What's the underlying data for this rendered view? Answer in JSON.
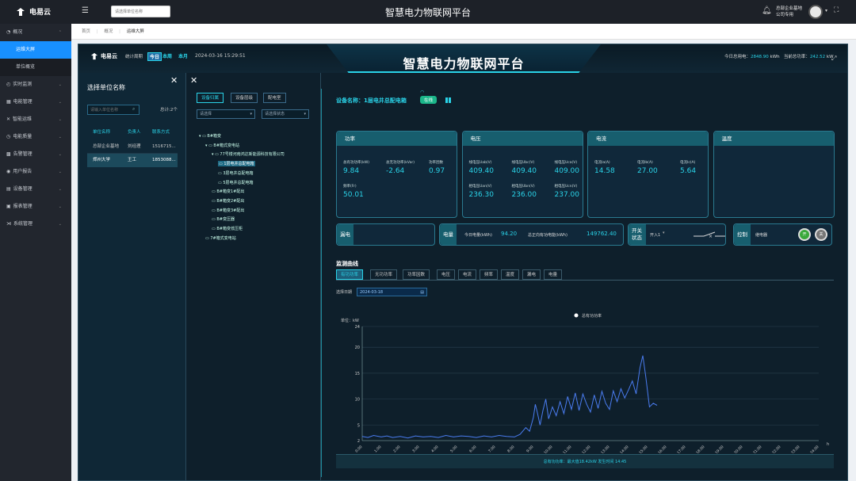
{
  "topbar": {
    "logo_text": "电易云",
    "menu_icon": "☰",
    "search_placeholder": "请选择单位名称",
    "title": "智慧电力物联网平台",
    "user_line1": "总部企业基地",
    "user_line2": "公司专用"
  },
  "sidebar": {
    "items": [
      {
        "label": "概况",
        "icon": "◔",
        "expanded": true
      },
      {
        "label": "运维大屏",
        "sub": true,
        "active": true
      },
      {
        "label": "单位概览",
        "sub": true
      },
      {
        "label": "实时监测",
        "icon": "◴"
      },
      {
        "label": "电能管理",
        "icon": "▦"
      },
      {
        "label": "智能运维",
        "icon": "✕"
      },
      {
        "label": "电能质量",
        "icon": "◷"
      },
      {
        "label": "告警管理",
        "icon": "▩"
      },
      {
        "label": "用户报告",
        "icon": "◉"
      },
      {
        "label": "设备管理",
        "icon": "▤"
      },
      {
        "label": "报表管理",
        "icon": "▣"
      },
      {
        "label": "系统管理",
        "icon": "⋊"
      }
    ]
  },
  "breadcrumb": [
    "首页",
    "概况",
    "运维大屏"
  ],
  "screen": {
    "logo_text": "电易云",
    "stat_label": "统计周期",
    "periods": [
      "今日",
      "本周",
      "本月"
    ],
    "time": "2024-03-16 15:29:51",
    "title": "智慧电力物联网平台",
    "today_label": "今日总用电：",
    "today_value": "2848.90",
    "today_unit": "kWh",
    "power_label": "当前总功率：",
    "power_value": "242.52",
    "power_unit": "kW"
  },
  "units_panel": {
    "title": "选择单位名称",
    "search_placeholder": "请输入单位名称",
    "total": "总计:2个",
    "headers": [
      "单位名称",
      "负责人",
      "联系方式"
    ],
    "rows": [
      [
        "总部企业基地",
        "刘经理",
        "1516715..."
      ],
      [
        "郑州大学",
        "王工",
        "1853088..."
      ]
    ]
  },
  "tree_panel": {
    "tabs": [
      "设备归属",
      "设备层级",
      "配电室"
    ],
    "select1": "请选择",
    "select2": "请选择状态",
    "nodes": [
      {
        "label": "B#箱变",
        "depth": 0
      },
      {
        "label": "B#箱式变电站",
        "depth": 1
      },
      {
        "label": "77号楼河南鸿达新能源科技有限公司",
        "depth": 2
      },
      {
        "label": "1层电井总配电箱",
        "depth": 3,
        "highlight": true
      },
      {
        "label": "3层电井总配电箱",
        "depth": 3
      },
      {
        "label": "5层电井总配电箱",
        "depth": 3
      },
      {
        "label": "B#箱变1#配出",
        "depth": 2
      },
      {
        "label": "B#箱变2#配出",
        "depth": 2
      },
      {
        "label": "B#箱变3#配出",
        "depth": 2
      },
      {
        "label": "B#变压器",
        "depth": 2
      },
      {
        "label": "B#箱变低压柜",
        "depth": 2
      },
      {
        "label": "7#箱式变电站",
        "depth": 1
      }
    ]
  },
  "detail": {
    "device_label": "设备名称：1层电井总配电箱",
    "status": "在线",
    "cards": [
      {
        "title": "功率",
        "metrics": [
          {
            "label": "总有功功率(kW)",
            "value": "9.84"
          },
          {
            "label": "总无功功率(kVar)",
            "value": "-2.64"
          },
          {
            "label": "功率因数",
            "value": "0.97"
          },
          {
            "label": "频率(Fr)",
            "value": "50.01"
          }
        ]
      },
      {
        "title": "电压",
        "metrics": [
          {
            "label": "线电压Uab(V)",
            "value": "409.40"
          },
          {
            "label": "线电压Ubc(V)",
            "value": "409.40"
          },
          {
            "label": "线电压Uca(V)",
            "value": "409.00"
          },
          {
            "label": "相电压Uan(V)",
            "value": "236.30"
          },
          {
            "label": "相电压Ubn(V)",
            "value": "236.00"
          },
          {
            "label": "相电压Ucn(V)",
            "value": "237.00"
          }
        ]
      },
      {
        "title": "电流",
        "metrics": [
          {
            "label": "电流Ia(A)",
            "value": "14.58"
          },
          {
            "label": "电流Ib(A)",
            "value": "27.00"
          },
          {
            "label": "电流Ic(A)",
            "value": "5.64"
          }
        ]
      },
      {
        "title": "温度",
        "metrics": []
      }
    ],
    "leak_label": "漏电",
    "energy_label": "电量",
    "energy_today_label": "今日电量(kWh)",
    "energy_today_value": "94.20",
    "energy_total_label": "总正向有功电能(kWh)",
    "energy_total_value": "149762.40",
    "switch_label": "开关状态",
    "switch_value": "开入1",
    "control_label": "控制",
    "control_device": "继电器",
    "control_on": "开",
    "control_off": "关",
    "section_title": "监测曲线",
    "tabs": [
      "有功功率",
      "无功功率",
      "功率因数",
      "电压",
      "电流",
      "频率",
      "温度",
      "漏电",
      "电量"
    ],
    "date_label": "选择日期",
    "date_value": "2024-03-18",
    "footer": "总有功功率：最大值18.42kW 发生时间 14:45"
  },
  "chart_data": {
    "type": "line",
    "legend": "总有功功率",
    "ylabel": "单位：kW",
    "ylim": [
      2,
      24
    ],
    "yticks": [
      2,
      5,
      10,
      15,
      20,
      24
    ],
    "xlim": [
      0,
      24
    ],
    "xticks": [
      "0:00",
      "1:00",
      "2:00",
      "3:00",
      "4:00",
      "5:00",
      "6:00",
      "7:00",
      "8:00",
      "9:00",
      "10:00",
      "11:00",
      "12:00",
      "13:00",
      "14:00",
      "15:00",
      "16:00",
      "17:00",
      "18:00",
      "19:00",
      "20:00",
      "21:00",
      "22:00",
      "23:00",
      "24:00"
    ],
    "xunit": "h",
    "x": [
      0,
      0.3,
      0.6,
      1,
      1.3,
      1.6,
      2,
      2.4,
      2.8,
      3.2,
      3.6,
      4,
      4.4,
      4.8,
      5.2,
      5.6,
      6,
      6.4,
      6.8,
      7.2,
      7.6,
      8,
      8.3,
      8.6,
      8.8,
      9,
      9.1,
      9.2,
      9.35,
      9.5,
      9.65,
      9.8,
      10,
      10.2,
      10.4,
      10.6,
      10.8,
      11,
      11.2,
      11.4,
      11.6,
      11.8,
      12,
      12.2,
      12.4,
      12.6,
      12.8,
      13,
      13.2,
      13.4,
      13.6,
      13.8,
      14,
      14.2,
      14.4,
      14.6,
      14.75,
      14.9,
      15.1,
      15.3,
      15.5
    ],
    "y": [
      2.8,
      2.6,
      3.0,
      2.7,
      2.9,
      2.6,
      2.8,
      2.5,
      2.9,
      2.7,
      2.8,
      2.6,
      3.0,
      2.7,
      2.9,
      2.8,
      2.6,
      2.9,
      2.7,
      3.0,
      2.8,
      2.7,
      3.2,
      4.5,
      3.8,
      6.5,
      9.0,
      7.5,
      5.0,
      7.8,
      10.0,
      6.2,
      8.5,
      6.8,
      9.5,
      7.2,
      10.5,
      8.0,
      11.2,
      7.8,
      11.0,
      9.0,
      7.5,
      10.8,
      8.2,
      11.5,
      9.2,
      8.0,
      11.6,
      9.5,
      12.0,
      10.2,
      11.8,
      13.5,
      11.0,
      16.0,
      18.4,
      14.5,
      8.5,
      9.2,
      8.8
    ]
  }
}
